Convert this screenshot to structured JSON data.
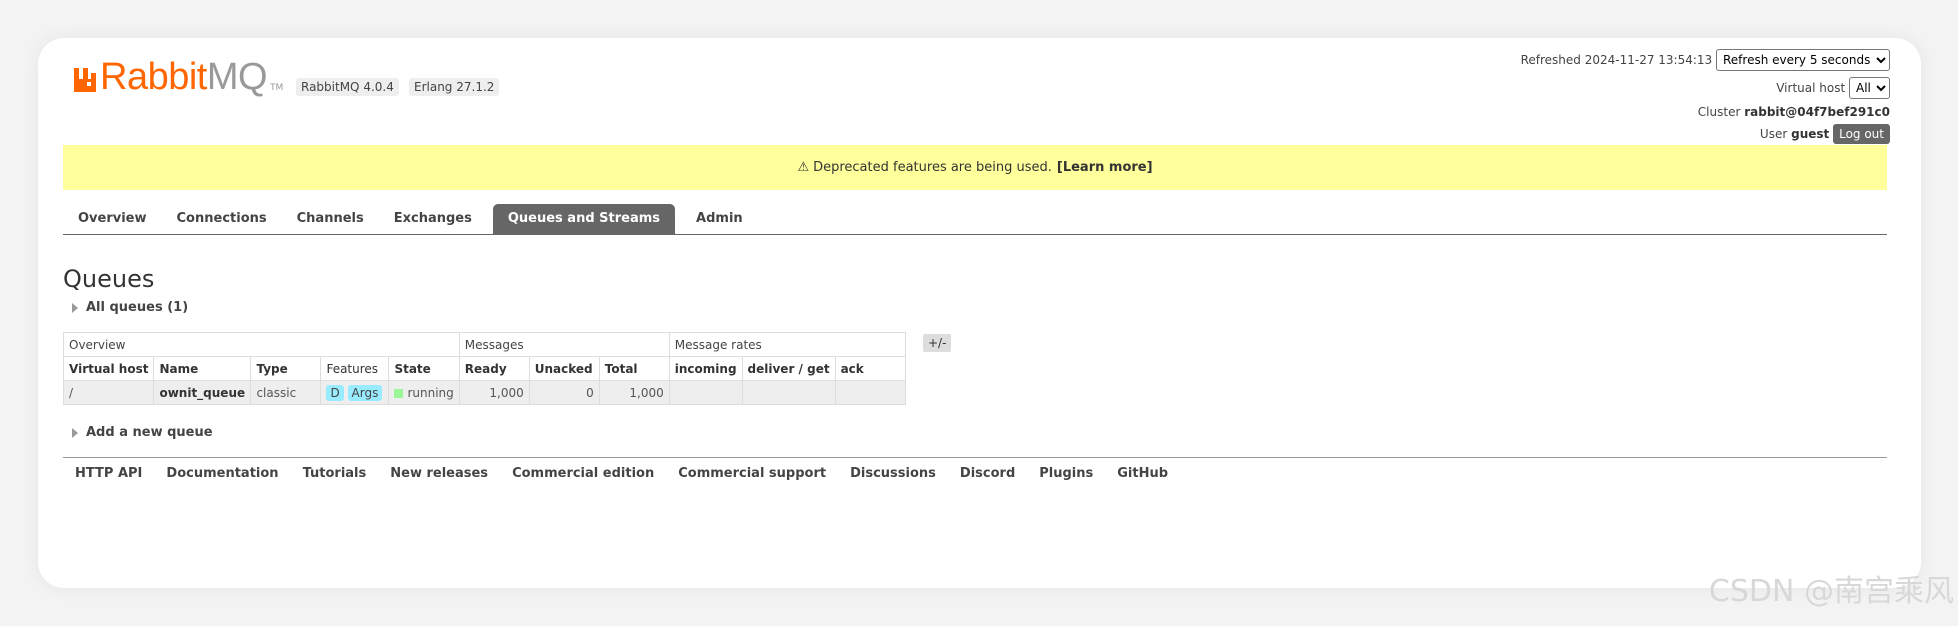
{
  "brand": {
    "rabbit": "Rabbit",
    "mq": "MQ",
    "tm": "TM"
  },
  "versions": {
    "rabbitmq": "RabbitMQ 4.0.4",
    "erlang": "Erlang 27.1.2"
  },
  "header": {
    "refreshed_label": "Refreshed",
    "refreshed_time": "2024-11-27 13:54:13",
    "refresh_option": "Refresh every 5 seconds",
    "vhost_label": "Virtual host",
    "vhost_value": "All",
    "cluster_label": "Cluster",
    "cluster_value": "rabbit@04f7bef291c0",
    "user_label": "User",
    "user_value": "guest",
    "logout": "Log out"
  },
  "banner": {
    "warning_icon": "⚠",
    "text": "Deprecated features are being used.",
    "link": "[Learn more]"
  },
  "tabs": [
    "Overview",
    "Connections",
    "Channels",
    "Exchanges",
    "Queues and Streams",
    "Admin"
  ],
  "page_title": "Queues",
  "all_queues": "All queues (1)",
  "table": {
    "groups": {
      "overview": "Overview",
      "messages": "Messages",
      "rates": "Message rates"
    },
    "columns": [
      "Virtual host",
      "Name",
      "Type",
      "Features",
      "State",
      "Ready",
      "Unacked",
      "Total",
      "incoming",
      "deliver / get",
      "ack"
    ],
    "rows": [
      {
        "vhost": "/",
        "name": "ownit_queue",
        "type": "classic",
        "feature_d": "D",
        "feature_args": "Args",
        "state": "running",
        "ready": "1,000",
        "unacked": "0",
        "total": "1,000",
        "incoming": "",
        "deliver_get": "",
        "ack": ""
      }
    ],
    "toggle": "+/-"
  },
  "add_queue": "Add a new queue",
  "footer": [
    "HTTP API",
    "Documentation",
    "Tutorials",
    "New releases",
    "Commercial edition",
    "Commercial support",
    "Discussions",
    "Discord",
    "Plugins",
    "GitHub"
  ],
  "watermark": "CSDN @南宫乘风",
  "colors": {
    "brand_orange": "#ff6600",
    "banner_yellow": "#ffff9c",
    "tab_active": "#666666",
    "feature_tag": "#99ebff",
    "running_green": "#98f898"
  }
}
